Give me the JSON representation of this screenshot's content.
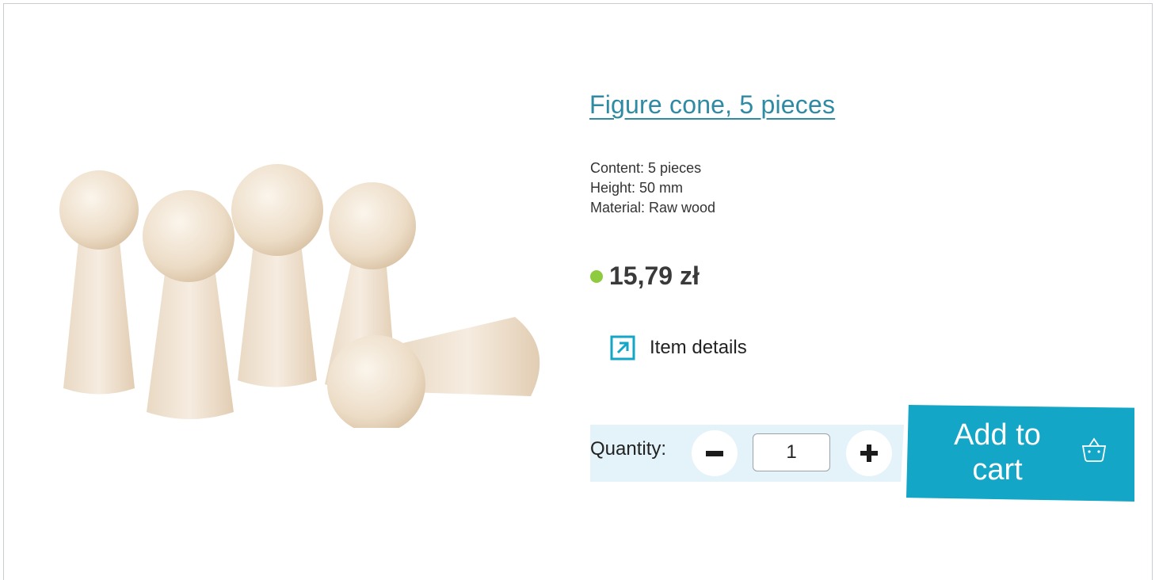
{
  "product": {
    "title": "Figure cone, 5 pieces",
    "specs": {
      "content": "Content: 5 pieces",
      "height": "Height: 50 mm",
      "material": "Material: Raw wood"
    },
    "price": "15,79 zł",
    "stock_color": "#8fcb3f",
    "image_icon": "wooden-figure-cones-photo"
  },
  "details_link": {
    "label": "Item details",
    "icon": "external-arrow-icon"
  },
  "quantity": {
    "label": "Quantity:",
    "value": "1",
    "minus_icon": "minus-icon",
    "plus_icon": "plus-icon"
  },
  "cart": {
    "label": "Add to cart",
    "icon": "basket-icon",
    "color": "#13a6c6"
  },
  "colors": {
    "accent": "#2f8aa3",
    "band": "#e4f3fa"
  }
}
